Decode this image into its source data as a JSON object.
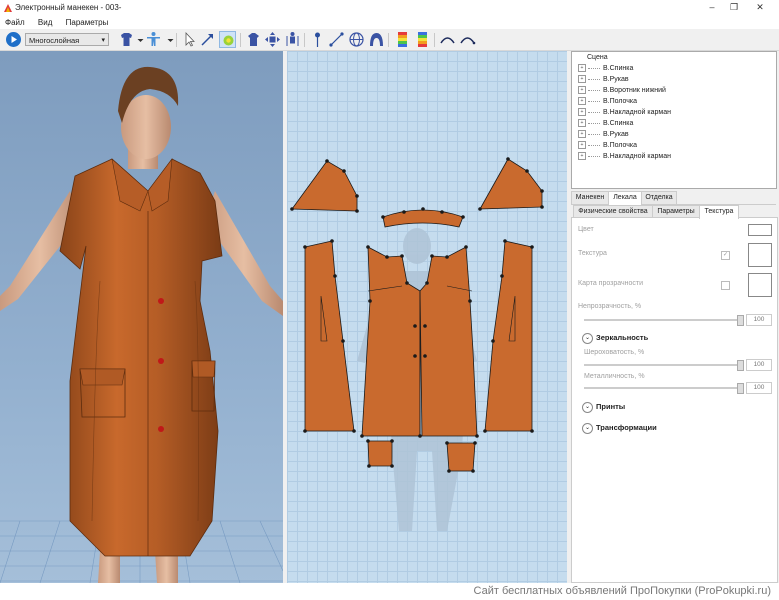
{
  "window": {
    "title": "Электронный манекен - 003-"
  },
  "menu": [
    "Файл",
    "Вид",
    "Параметры"
  ],
  "toolbar": {
    "mode_select": "Многослойная",
    "icons": [
      "play-icon",
      "shirt-icon",
      "mannequin-icon",
      "cursor-icon",
      "arrow-tool-icon",
      "gear-flower-icon",
      "garment-front-icon",
      "garment-move-icon",
      "figure-icon",
      "pin-icon",
      "measure-icon",
      "sphere-icon",
      "hood-icon",
      "color-bar-icon",
      "color-bar-2-icon",
      "arc-left-icon",
      "arc-right-icon"
    ]
  },
  "tree": {
    "root": "Сцена",
    "items": [
      "В.Спинка",
      "В.Рукав",
      "В.Воротник нижний",
      "В.Полочка",
      "В.Накладной карман",
      "В.Спинка",
      "В.Рукав",
      "В.Полочка",
      "В.Накладной карман"
    ]
  },
  "tabs_main": [
    "Манекен",
    "Лекала",
    "Отделка"
  ],
  "tabs_sub": [
    "Физические свойства",
    "Параметры",
    "Текстура"
  ],
  "props": {
    "color": "Цвет",
    "texture": "Текстура",
    "transparency_map": "Карта прозрачности",
    "opacity": "Непрозрачность, %",
    "opacity_value": "100",
    "mirror": "Зеркальность",
    "roughness": "Шероховатость, %",
    "roughness_value": "100",
    "metallic": "Металличность, %",
    "metallic_value": "100",
    "prints": "Принты",
    "transforms": "Трансформации"
  },
  "footer": {
    "watermark": "Сайт бесплатных объявлений ПроПокупки (ProPokupki.ru)"
  },
  "colors": {
    "fabric": "#c4642a",
    "accent": "#1f6fc8"
  }
}
